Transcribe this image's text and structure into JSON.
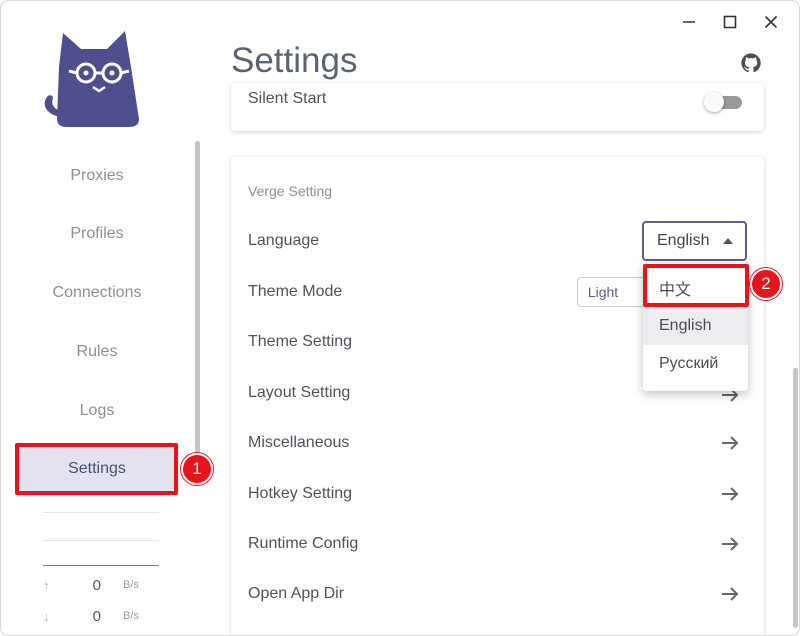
{
  "page_title": "Settings",
  "sidebar": {
    "items": [
      {
        "label": "Proxies",
        "active": false
      },
      {
        "label": "Profiles",
        "active": false
      },
      {
        "label": "Connections",
        "active": false
      },
      {
        "label": "Rules",
        "active": false
      },
      {
        "label": "Logs",
        "active": false
      },
      {
        "label": "Settings",
        "active": true
      }
    ],
    "traffic": {
      "upload": {
        "value": "0",
        "unit": "B/s",
        "icon": "arrow-up-icon"
      },
      "download": {
        "value": "0",
        "unit": "B/s",
        "icon": "arrow-down-icon"
      }
    }
  },
  "top_card": {
    "silent_start_label": "Silent Start",
    "silent_start_on": false
  },
  "verge_card": {
    "section_label": "Verge Setting",
    "language_label": "Language",
    "language_value": "English",
    "theme_mode_label": "Theme Mode",
    "theme_light_label": "Light",
    "rows": [
      {
        "label": "Theme Setting"
      },
      {
        "label": "Layout Setting"
      },
      {
        "label": "Miscellaneous"
      },
      {
        "label": "Hotkey Setting"
      },
      {
        "label": "Runtime Config"
      },
      {
        "label": "Open App Dir"
      }
    ]
  },
  "language_dropdown": {
    "options": [
      "中文",
      "English",
      "Русский"
    ],
    "selected": "English"
  },
  "annotations": {
    "badge_1": "1",
    "badge_2": "2"
  },
  "colors": {
    "accent": "#5b5f8c",
    "annotation_red": "#e8141b",
    "active_nav_bg": "#e3e3f0"
  }
}
